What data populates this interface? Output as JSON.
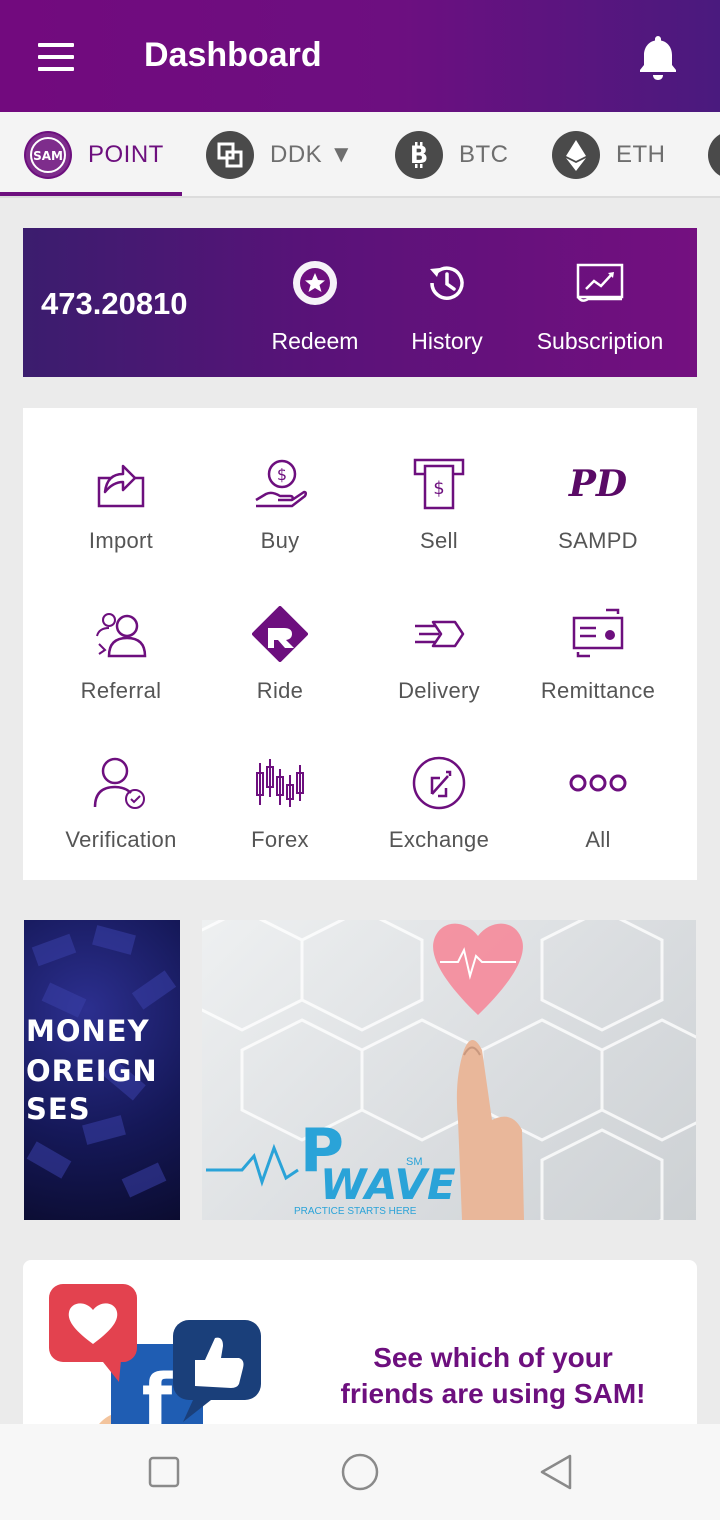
{
  "appbar": {
    "title": "Dashboard",
    "menu_icon": "hamburger-icon",
    "notify_icon": "bell-icon"
  },
  "coin_tabs": [
    {
      "label": "POINT",
      "icon": "sam-logo-icon",
      "active": true
    },
    {
      "label": "DDK ▼",
      "icon": "ddk-icon"
    },
    {
      "label": "BTC",
      "icon": "bitcoin-icon"
    },
    {
      "label": "ETH",
      "icon": "ethereum-icon"
    }
  ],
  "balance": {
    "amount": "473.20810",
    "actions": [
      {
        "label": "Redeem",
        "icon": "star-badge-icon"
      },
      {
        "label": "History",
        "icon": "history-icon"
      },
      {
        "label": "Subscription",
        "icon": "chart-board-icon"
      }
    ]
  },
  "services": [
    {
      "label": "Import",
      "icon": "import-icon"
    },
    {
      "label": "Buy",
      "icon": "buy-icon"
    },
    {
      "label": "Sell",
      "icon": "sell-icon"
    },
    {
      "label": "SAMPD",
      "icon": "sampd-icon"
    },
    {
      "label": "Referral",
      "icon": "referral-icon"
    },
    {
      "label": "Ride",
      "icon": "ride-icon"
    },
    {
      "label": "Delivery",
      "icon": "delivery-icon"
    },
    {
      "label": "Remittance",
      "icon": "remittance-icon"
    },
    {
      "label": "Verification",
      "icon": "verification-icon"
    },
    {
      "label": "Forex",
      "icon": "forex-icon"
    },
    {
      "label": "Exchange",
      "icon": "exchange-icon"
    },
    {
      "label": "All",
      "icon": "more-icon"
    }
  ],
  "sampd_logo_text": "PD",
  "banners": {
    "left_lines": [
      "MONEY",
      "OREIGN",
      "SES"
    ],
    "right_brand": "WAVE",
    "right_brand_mark": "SM",
    "right_tagline": "PRACTICE STARTS HERE",
    "right_logo_letter": "P"
  },
  "friends_card": {
    "message_line1": "See which of your",
    "message_line2": "friends are using SAM!",
    "logo_letter": "f"
  },
  "colors": {
    "brand": "#6d0f7e",
    "appbar_end": "#4a1a7e",
    "balance_start": "#3b1d6e"
  }
}
